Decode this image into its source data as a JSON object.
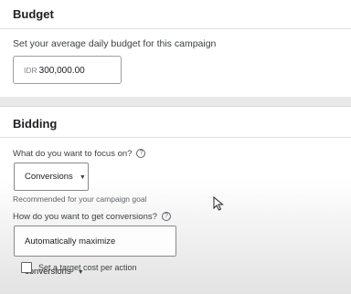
{
  "budget": {
    "title": "Budget",
    "prompt": "Set your average daily budget for this campaign",
    "currency": "IDR",
    "amount": "300,000.00"
  },
  "bidding": {
    "title": "Bidding",
    "focus_question": "What do you want to focus on?",
    "focus_value": "Conversions",
    "focus_hint": "Recommended for your campaign goal",
    "method_question": "How do you want to get conversions?",
    "method_value": "Automatically maximize conversions",
    "target_cpa_label": "Set a target cost per action",
    "target_cpa_checked": false
  },
  "icons": {
    "help": "help-circle-icon",
    "caret": "caret-down-icon",
    "cursor": "mouse-pointer-icon"
  },
  "colors": {
    "border": "#8a8a8a",
    "text": "#3c4043",
    "muted": "#80868b"
  }
}
